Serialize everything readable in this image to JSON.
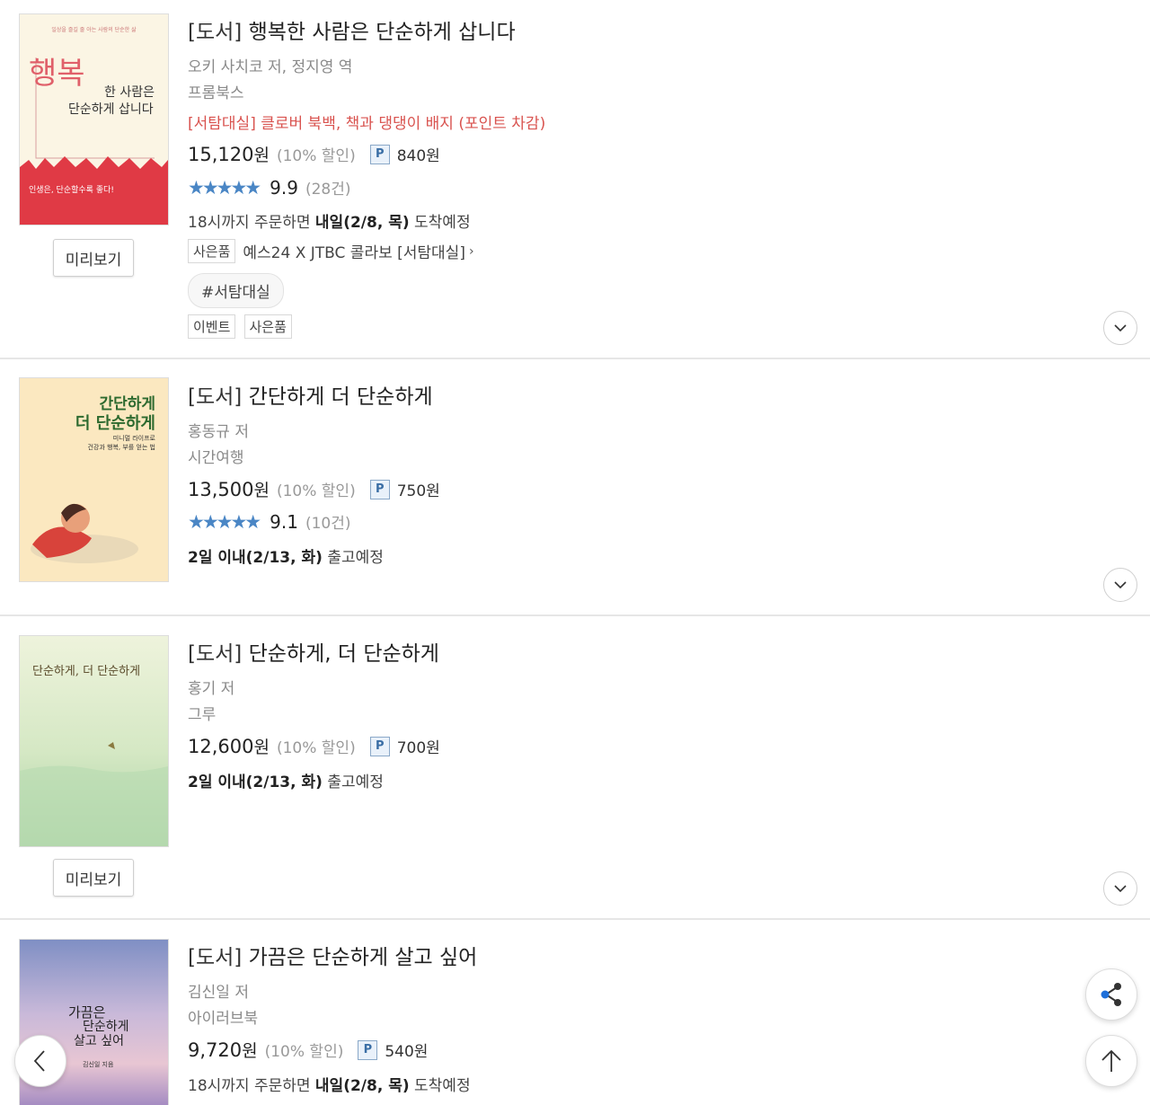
{
  "books": [
    {
      "category": "[도서]",
      "title": "행복한 사람은 단순하게 삽니다",
      "author": "오키 사치코 저, 정지영 역",
      "publisher": "프롬북스",
      "promo": "[서탐대실] 클로버 북백, 책과 댕댕이 배지 (포인트 차감)",
      "price": "15,120",
      "currency": "원",
      "discount": "(10% 할인)",
      "points_badge": "P",
      "points": "840원",
      "rating": "9.9",
      "rating_count": "(28건)",
      "delivery_prefix": "18시까지 주문하면 ",
      "delivery_bold": "내일(2/8, 목)",
      "delivery_suffix": " 도착예정",
      "gift_tag": "사은품",
      "gift_text": "예스24 X JTBC 콜라보 [서탐대실]",
      "hashtag": "#서탐대실",
      "tags": [
        "이벤트",
        "사은품"
      ],
      "preview_label": "미리보기",
      "cover": {
        "top_text": "일상을 즐길 줄 아는 사람의 단순한 삶",
        "big": "행복",
        "line1": "한 사람은",
        "line2": "단순하게 삽니다",
        "band_text": "인생은, 단순할수록 좋다!"
      }
    },
    {
      "category": "[도서]",
      "title": "간단하게 더 단순하게",
      "author": "홍동규 저",
      "publisher": "시간여행",
      "price": "13,500",
      "currency": "원",
      "discount": "(10% 할인)",
      "points_badge": "P",
      "points": "750원",
      "rating": "9.1",
      "rating_count": "(10건)",
      "delivery_bold": "2일 이내(2/13, 화)",
      "delivery_suffix": " 출고예정",
      "cover": {
        "line1": "간단하게",
        "line2": "더 단순하게",
        "sub1": "미니멀 라이프로",
        "sub2": "건강과 행복, 부를 얻는 법"
      }
    },
    {
      "category": "[도서]",
      "title": "단순하게, 더 단순하게",
      "author": "홍기 저",
      "publisher": "그루",
      "price": "12,600",
      "currency": "원",
      "discount": "(10% 할인)",
      "points_badge": "P",
      "points": "700원",
      "delivery_bold": "2일 이내(2/13, 화)",
      "delivery_suffix": " 출고예정",
      "preview_label": "미리보기",
      "cover": {
        "title": "단순하게, 더 단순하게"
      }
    },
    {
      "category": "[도서]",
      "title": "가끔은 단순하게 살고 싶어",
      "author": "김신일 저",
      "publisher": "아이러브북",
      "price": "9,720",
      "currency": "원",
      "discount": "(10% 할인)",
      "points_badge": "P",
      "points": "540원",
      "delivery_prefix": "18시까지 주문하면 ",
      "delivery_bold": "내일(2/8, 목)",
      "delivery_suffix": " 도착예정",
      "cover": {
        "line1": "가끔은",
        "line2": "단순하게",
        "line3": "살고 싶어",
        "author": "김신일 지음"
      }
    }
  ],
  "icons": {
    "expand": "chevron-down-icon",
    "share": "share-icon",
    "back": "chevron-left-icon",
    "top": "arrow-up-icon"
  },
  "colors": {
    "accent_blue": "#4a86c5",
    "promo_red": "#d9534f"
  }
}
